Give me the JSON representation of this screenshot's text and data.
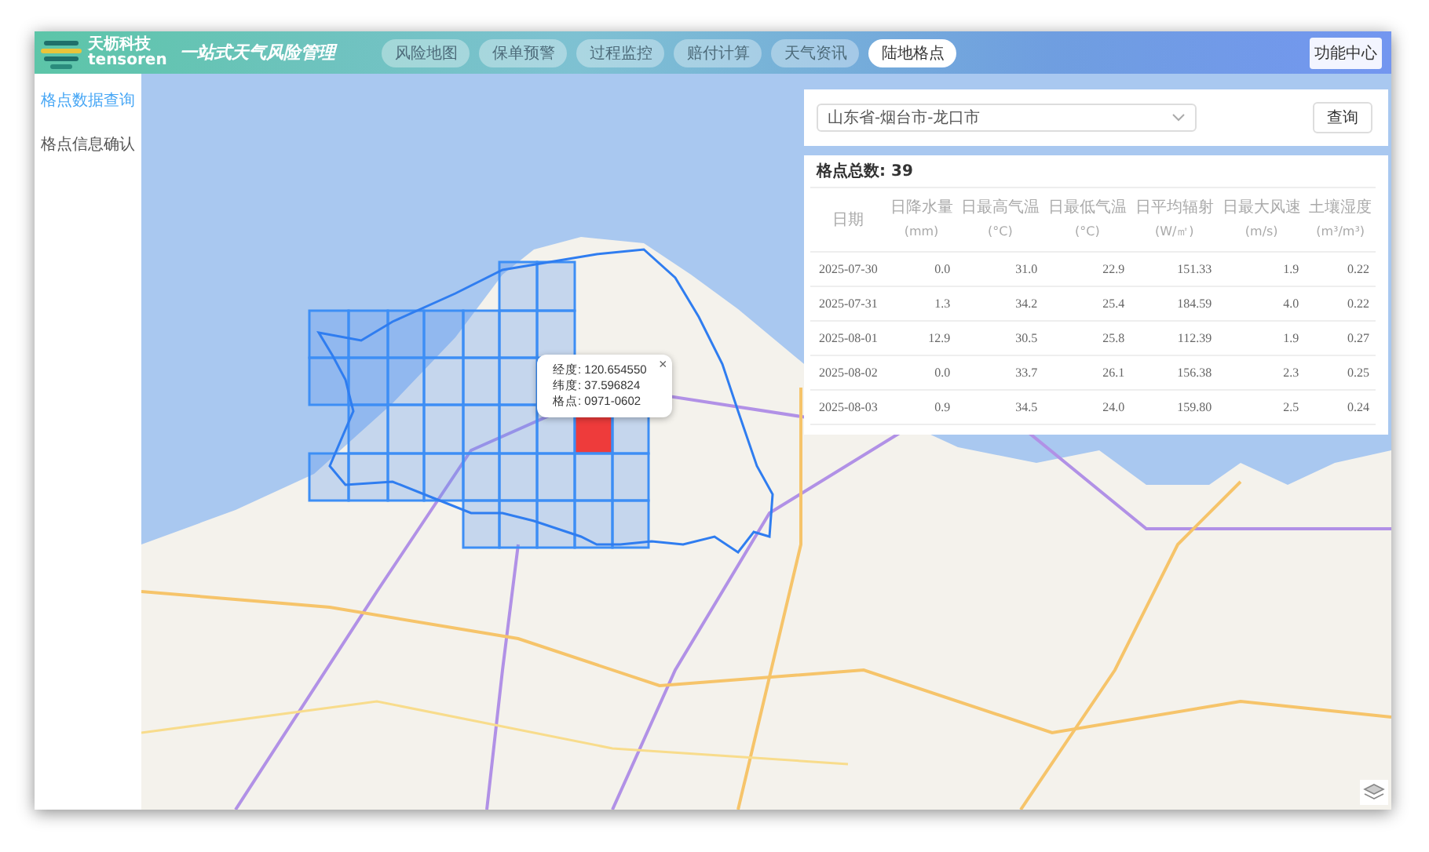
{
  "header": {
    "logo_text": "天枥科技",
    "logo_subtext": "tensoren",
    "title": "一站式天气风险管理",
    "tabs": [
      {
        "label": "风险地图",
        "selected": false
      },
      {
        "label": "保单预警",
        "selected": false
      },
      {
        "label": "过程监控",
        "selected": false
      },
      {
        "label": "赔付计算",
        "selected": false
      },
      {
        "label": "天气资讯",
        "selected": false
      },
      {
        "label": "陆地格点",
        "selected": true
      }
    ],
    "function_button": "功能中心"
  },
  "sidebar": {
    "items": [
      {
        "label": "格点数据查询",
        "selected": true
      },
      {
        "label": "格点信息确认",
        "selected": false
      }
    ]
  },
  "query": {
    "region_value": "山东省-烟台市-龙口市",
    "button": "查询"
  },
  "table": {
    "summary": "格点总数: 39",
    "columns": [
      {
        "name": "日期"
      },
      {
        "name": "日降水量",
        "unit": "(mm)"
      },
      {
        "name": "日最高气温",
        "unit": "(°C)"
      },
      {
        "name": "日最低气温",
        "unit": "(°C)"
      },
      {
        "name": "日平均辐射",
        "unit": "(W/㎡)"
      },
      {
        "name": "日最大风速",
        "unit": "(m/s)"
      },
      {
        "name": "土壤湿度",
        "unit": "(m³/m³)"
      }
    ],
    "rows": [
      [
        "2025-07-30",
        "0.0",
        "31.0",
        "22.9",
        "151.33",
        "1.9",
        "0.22"
      ],
      [
        "2025-07-31",
        "1.3",
        "34.2",
        "25.4",
        "184.59",
        "4.0",
        "0.22"
      ],
      [
        "2025-08-01",
        "12.9",
        "30.5",
        "25.8",
        "112.39",
        "1.9",
        "0.27"
      ],
      [
        "2025-08-02",
        "0.0",
        "33.7",
        "26.1",
        "156.38",
        "2.3",
        "0.25"
      ],
      [
        "2025-08-03",
        "0.9",
        "34.5",
        "24.0",
        "159.80",
        "2.5",
        "0.24"
      ]
    ]
  },
  "map": {
    "popup": {
      "lines": [
        "经度: 120.654550",
        "纬度: 37.596824",
        "格点: 0971-0602"
      ],
      "close": "×"
    },
    "grid_cells": [
      {
        "selected": false
      },
      {
        "selected": false
      },
      {
        "selected": false
      },
      {
        "selected": false
      },
      {
        "selected": false
      },
      {
        "selected": false
      },
      {
        "selected": false
      },
      {
        "selected": false
      },
      {
        "selected": false
      },
      {
        "selected": false
      },
      {
        "selected": false
      },
      {
        "selected": false
      },
      {
        "selected": false
      },
      {
        "selected": false
      },
      {
        "selected": false
      },
      {
        "selected": false
      },
      {
        "selected": false
      },
      {
        "selected": false
      },
      {
        "selected": false
      },
      {
        "selected": false
      },
      {
        "selected": false
      },
      {
        "selected": true
      },
      {
        "selected": false
      },
      {
        "selected": false
      },
      {
        "selected": false
      },
      {
        "selected": false
      },
      {
        "selected": false
      },
      {
        "selected": false
      },
      {
        "selected": false
      },
      {
        "selected": false
      },
      {
        "selected": false
      },
      {
        "selected": false
      },
      {
        "selected": false
      },
      {
        "selected": false
      },
      {
        "selected": false
      },
      {
        "selected": false
      },
      {
        "selected": false
      }
    ]
  }
}
